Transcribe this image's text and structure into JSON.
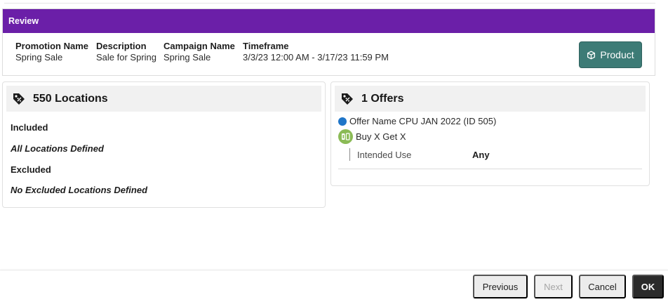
{
  "review": {
    "title": "Review",
    "columns": [
      {
        "label": "Promotion Name",
        "value": "Spring Sale"
      },
      {
        "label": "Description",
        "value": "Sale for Spring"
      },
      {
        "label": "Campaign Name",
        "value": "Spring Sale"
      },
      {
        "label": "Timeframe",
        "value": "3/3/23 12:00 AM - 3/17/23 11:59 PM"
      }
    ],
    "product_button": "Product"
  },
  "locations": {
    "title": "550 Locations",
    "included_label": "Included",
    "included_value": "All Locations Defined",
    "excluded_label": "Excluded",
    "excluded_value": "No Excluded Locations Defined"
  },
  "offers": {
    "title": "1 Offers",
    "offer_name": "Offer Name CPU JAN 2022 (ID 505)",
    "offer_type": "Buy X Get X",
    "intended_use_label": "Intended Use",
    "intended_use_value": "Any"
  },
  "footer": {
    "previous": "Previous",
    "next": "Next",
    "cancel": "Cancel",
    "ok": "OK"
  },
  "colors": {
    "header_purple": "#6b1fa8",
    "product_teal": "#3d7b76",
    "offer_dot_blue": "#1f75c8",
    "bxgy_green": "#8bbb56"
  },
  "icons": {
    "product": "cube-icon",
    "locations": "price-tag-icon",
    "offers": "price-tag-icon",
    "offer_status": "status-dot-icon",
    "offer_type": "buy-x-get-x-icon"
  }
}
